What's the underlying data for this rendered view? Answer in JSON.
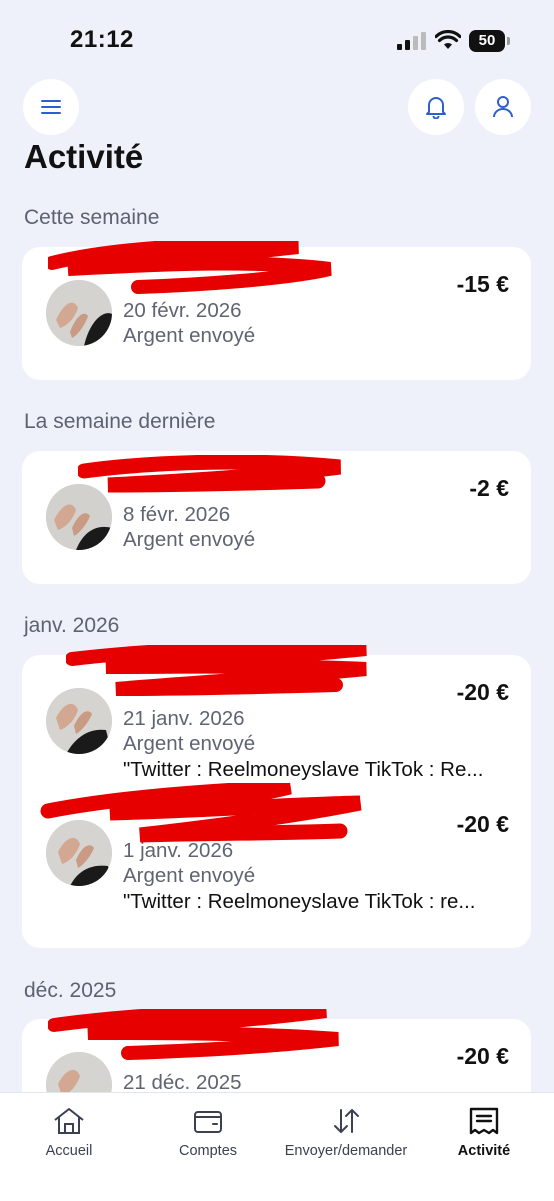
{
  "status_bar": {
    "time": "21:12",
    "battery": "50"
  },
  "header": {
    "title": "Activité",
    "icons": [
      "menu-icon",
      "bell-icon",
      "user-icon"
    ]
  },
  "colors": {
    "accent": "#2f5fcf",
    "background": "#eef1fa",
    "redaction": "#e60000"
  },
  "sections": [
    {
      "title": "Cette semaine",
      "transactions": [
        {
          "date": "20 févr. 2026",
          "type": "Argent envoyé",
          "amount": "-15 €"
        }
      ]
    },
    {
      "title": "La semaine dernière",
      "transactions": [
        {
          "date": "8 févr. 2026",
          "type": "Argent envoyé",
          "amount": "-2 €"
        }
      ]
    },
    {
      "title": "janv. 2026",
      "transactions": [
        {
          "date": "21 janv. 2026",
          "type": "Argent envoyé",
          "note": "\"Twitter : Reelmoneyslave TikTok : Re...",
          "amount": "-20 €"
        },
        {
          "date": "1 janv. 2026",
          "type": "Argent envoyé",
          "note": "\"Twitter : Reelmoneyslave TikTok : re...",
          "amount": "-20 €"
        }
      ]
    },
    {
      "title": "déc. 2025",
      "transactions": [
        {
          "date": "21 déc. 2025",
          "amount": "-20 €"
        }
      ]
    }
  ],
  "tabbar": {
    "items": [
      {
        "label": "Accueil",
        "icon": "home-icon"
      },
      {
        "label": "Comptes",
        "icon": "wallet-icon"
      },
      {
        "label": "Envoyer/demander",
        "icon": "transfer-arrows-icon"
      },
      {
        "label": "Activité",
        "icon": "receipt-icon",
        "active": true
      }
    ]
  }
}
